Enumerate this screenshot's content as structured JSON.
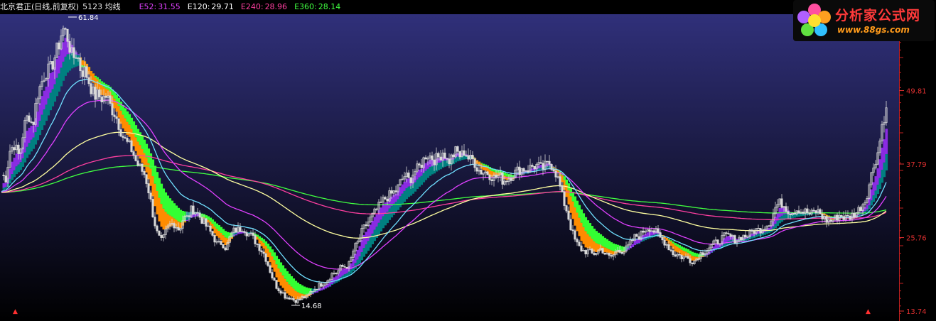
{
  "header": {
    "stock_title": "北京君正(日线,前复权)",
    "indicator_name": "5123 均线",
    "ma_readouts": [
      {
        "label": "E52:",
        "value": "31.55",
        "color": "#e040ff"
      },
      {
        "label": "E120:",
        "value": "29.71",
        "color": "#ffffc0"
      },
      {
        "label": "E240:",
        "value": "28.96",
        "color": "#ff3fa0"
      },
      {
        "label": "E360:",
        "value": "28.14",
        "color": "#40ff40"
      }
    ]
  },
  "logo": {
    "title": "分析家公式网",
    "url": "www.88gs.com"
  },
  "chart_data": {
    "type": "candlestick",
    "price_axis_ticks": [
      "49.81",
      "37.79",
      "25.76",
      "13.74"
    ],
    "price_axis_values": [
      49.81,
      37.79,
      25.76,
      13.74
    ],
    "ylim": [
      13.74,
      61.84
    ],
    "annotations": [
      {
        "label": "61.84",
        "value": 61.84,
        "kind": "high"
      },
      {
        "label": "14.68",
        "value": 14.68,
        "kind": "low"
      }
    ],
    "close_anchors": [
      [
        0,
        36
      ],
      [
        6,
        35.5
      ],
      [
        12,
        40
      ],
      [
        18,
        41
      ],
      [
        25,
        39
      ],
      [
        32,
        44
      ],
      [
        38,
        46
      ],
      [
        44,
        44
      ],
      [
        50,
        49
      ],
      [
        56,
        51
      ],
      [
        62,
        53
      ],
      [
        68,
        53
      ],
      [
        74,
        55
      ],
      [
        80,
        57
      ],
      [
        86,
        60
      ],
      [
        92,
        59
      ],
      [
        96,
        57
      ],
      [
        100,
        55
      ],
      [
        106,
        56
      ],
      [
        112,
        53
      ],
      [
        118,
        53
      ],
      [
        124,
        51
      ],
      [
        130,
        49
      ],
      [
        136,
        49
      ],
      [
        142,
        48.5
      ],
      [
        148,
        49
      ],
      [
        154,
        47
      ],
      [
        160,
        46
      ],
      [
        166,
        44
      ],
      [
        172,
        42
      ],
      [
        178,
        41
      ],
      [
        184,
        40
      ],
      [
        190,
        38
      ],
      [
        196,
        37
      ],
      [
        202,
        36
      ],
      [
        208,
        33
      ],
      [
        214,
        29
      ],
      [
        220,
        26
      ],
      [
        226,
        25
      ],
      [
        232,
        27
      ],
      [
        238,
        28
      ],
      [
        244,
        28
      ],
      [
        250,
        27
      ],
      [
        256,
        29
      ],
      [
        262,
        29
      ],
      [
        268,
        30.5
      ],
      [
        274,
        30
      ],
      [
        280,
        29
      ],
      [
        286,
        28
      ],
      [
        292,
        27
      ],
      [
        298,
        26
      ],
      [
        304,
        24.5
      ],
      [
        310,
        25
      ],
      [
        316,
        24
      ],
      [
        322,
        26
      ],
      [
        328,
        27
      ],
      [
        334,
        27
      ],
      [
        340,
        27.5
      ],
      [
        346,
        26.5
      ],
      [
        352,
        26
      ],
      [
        358,
        25
      ],
      [
        364,
        24
      ],
      [
        370,
        23
      ],
      [
        376,
        21
      ],
      [
        382,
        19
      ],
      [
        388,
        17.5
      ],
      [
        394,
        17
      ],
      [
        400,
        16
      ],
      [
        406,
        16
      ],
      [
        412,
        15.5
      ],
      [
        418,
        15.5
      ],
      [
        424,
        16
      ],
      [
        430,
        16
      ],
      [
        436,
        17
      ],
      [
        442,
        17.5
      ],
      [
        448,
        18
      ],
      [
        454,
        18.5
      ],
      [
        460,
        19
      ],
      [
        466,
        20
      ],
      [
        472,
        20
      ],
      [
        478,
        21
      ],
      [
        484,
        21
      ],
      [
        490,
        21.5
      ],
      [
        496,
        24
      ],
      [
        502,
        25
      ],
      [
        508,
        27
      ],
      [
        514,
        28
      ],
      [
        520,
        29
      ],
      [
        526,
        30
      ],
      [
        532,
        31
      ],
      [
        538,
        32
      ],
      [
        544,
        32.5
      ],
      [
        550,
        33
      ],
      [
        556,
        33.5
      ],
      [
        562,
        35
      ],
      [
        568,
        36
      ],
      [
        574,
        35
      ],
      [
        580,
        36.5
      ],
      [
        586,
        37
      ],
      [
        592,
        38
      ],
      [
        598,
        39.5
      ],
      [
        604,
        39
      ],
      [
        610,
        38.5
      ],
      [
        616,
        39
      ],
      [
        622,
        40
      ],
      [
        628,
        38
      ],
      [
        634,
        39
      ],
      [
        640,
        40
      ],
      [
        646,
        39
      ],
      [
        652,
        40
      ],
      [
        658,
        38.5
      ],
      [
        664,
        38.5
      ],
      [
        670,
        37
      ],
      [
        676,
        36.5
      ],
      [
        682,
        36.5
      ],
      [
        688,
        36
      ],
      [
        694,
        35.5
      ],
      [
        700,
        36
      ],
      [
        706,
        35
      ],
      [
        712,
        35.5
      ],
      [
        718,
        36
      ],
      [
        724,
        36.5
      ],
      [
        730,
        37
      ],
      [
        736,
        37
      ],
      [
        742,
        37
      ],
      [
        748,
        37.5
      ],
      [
        754,
        37.5
      ],
      [
        760,
        37
      ],
      [
        766,
        37.5
      ],
      [
        772,
        38
      ],
      [
        778,
        37
      ],
      [
        784,
        35
      ],
      [
        790,
        32
      ],
      [
        796,
        30
      ],
      [
        802,
        27
      ],
      [
        808,
        25
      ],
      [
        814,
        24
      ],
      [
        820,
        23.5
      ],
      [
        826,
        23.5
      ],
      [
        832,
        23
      ],
      [
        838,
        23.5
      ],
      [
        844,
        24
      ],
      [
        850,
        23
      ],
      [
        856,
        22.5
      ],
      [
        862,
        23
      ],
      [
        868,
        24
      ],
      [
        874,
        23.5
      ],
      [
        880,
        24
      ],
      [
        886,
        25
      ],
      [
        892,
        26
      ],
      [
        898,
        26
      ],
      [
        904,
        27
      ],
      [
        910,
        27.5
      ],
      [
        916,
        27
      ],
      [
        922,
        26.5
      ],
      [
        928,
        25.5
      ],
      [
        934,
        25
      ],
      [
        940,
        24
      ],
      [
        946,
        23
      ],
      [
        952,
        23
      ],
      [
        958,
        22.5
      ],
      [
        964,
        22.5
      ],
      [
        970,
        22
      ],
      [
        976,
        22
      ],
      [
        982,
        23
      ],
      [
        988,
        23.5
      ],
      [
        994,
        24
      ],
      [
        1000,
        24.5
      ],
      [
        1006,
        25
      ],
      [
        1012,
        25.5
      ],
      [
        1018,
        26
      ],
      [
        1024,
        26
      ],
      [
        1030,
        25.5
      ],
      [
        1036,
        25.5
      ],
      [
        1042,
        26
      ],
      [
        1048,
        26
      ],
      [
        1054,
        26.5
      ],
      [
        1060,
        27
      ],
      [
        1066,
        27
      ],
      [
        1072,
        27.5
      ],
      [
        1078,
        28
      ],
      [
        1084,
        29
      ],
      [
        1090,
        31
      ],
      [
        1096,
        31.5
      ],
      [
        1102,
        31
      ],
      [
        1108,
        30
      ],
      [
        1114,
        30
      ],
      [
        1120,
        30.5
      ],
      [
        1126,
        30
      ],
      [
        1132,
        30
      ],
      [
        1138,
        29.5
      ],
      [
        1144,
        30
      ],
      [
        1150,
        30
      ],
      [
        1156,
        29
      ],
      [
        1162,
        28.5
      ],
      [
        1168,
        28.5
      ],
      [
        1174,
        29
      ],
      [
        1180,
        29.5
      ],
      [
        1186,
        29
      ],
      [
        1192,
        29
      ],
      [
        1198,
        29.5
      ],
      [
        1204,
        30
      ],
      [
        1210,
        31
      ],
      [
        1216,
        32
      ],
      [
        1222,
        35
      ],
      [
        1228,
        38
      ],
      [
        1234,
        40
      ],
      [
        1240,
        45
      ],
      [
        1246,
        47
      ]
    ],
    "last_close": 47,
    "ribbon_upper_colors": {
      "rising": "#8a2be2",
      "falling": "#ff8c00"
    },
    "ribbon_lower_colors": {
      "rising": "#008080",
      "falling": "#33ff33"
    },
    "ema_periods": [
      5,
      12,
      20,
      30,
      52,
      120,
      240,
      360
    ],
    "ema_line_colors": {
      "e20": "#70e0ff",
      "e52": "#e040ff",
      "e120": "#ffffa0",
      "e240": "#ff3fa0",
      "e360": "#40ff40"
    },
    "background_top": "#30307a",
    "background_bottom": "#000000",
    "candle_color": "#d8d8d8"
  }
}
